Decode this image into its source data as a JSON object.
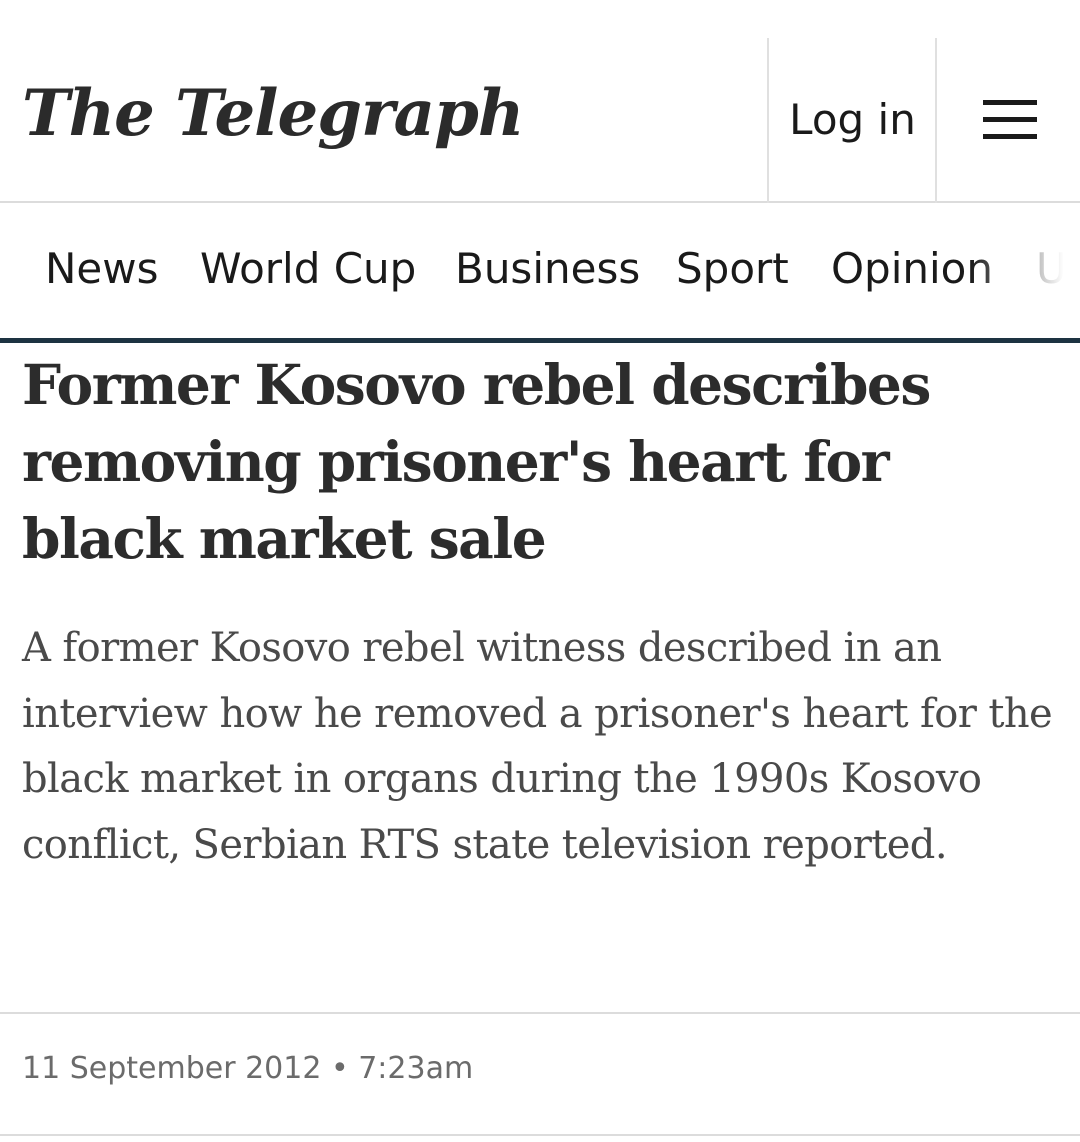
{
  "header": {
    "logo_text": "The Telegraph",
    "login_label": "Log in",
    "menu_icon": "hamburger-menu-icon"
  },
  "nav": {
    "items": [
      {
        "label": "News"
      },
      {
        "label": "World Cup"
      },
      {
        "label": "Business"
      },
      {
        "label": "Sport"
      },
      {
        "label": "Opinion"
      },
      {
        "label": "U"
      }
    ],
    "underline_color": "#1d3341"
  },
  "article": {
    "headline": "Former Kosovo rebel describes removing prisoner's heart for black market sale",
    "standfirst": "A former Kosovo rebel witness described in an interview how he removed a prisoner's heart for the black market in organs during the 1990s Kosovo conflict, Serbian RTS state television reported.",
    "date": "11 September 2012",
    "separator": "•",
    "time": "7:23am"
  }
}
